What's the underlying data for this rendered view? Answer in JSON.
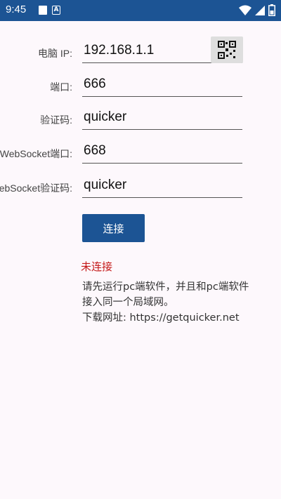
{
  "statusbar": {
    "time": "9:45",
    "notif_label": "A"
  },
  "form": {
    "ip_label": "电脑 IP:",
    "ip_value": "192.168.1.1",
    "port_label": "端口:",
    "port_value": "666",
    "code_label": "验证码:",
    "code_value": "quicker",
    "ws_port_label": "WebSocket端口:",
    "ws_port_value": "668",
    "ws_code_label": "WebSocket验证码:",
    "ws_code_value": "quicker"
  },
  "connect_label": "连接",
  "status_text": "未连接",
  "info": {
    "line1": "请先运行pc端软件，并且和pc端软件",
    "line2": "接入同一个局域网。",
    "line3": "下载网址: https://getquicker.net"
  },
  "colors": {
    "accent": "#1c5494",
    "status": "#c41818",
    "background": "#fdf8fc"
  },
  "icons": [
    "wifi-icon",
    "signal-icon",
    "battery-icon",
    "qr-code-icon"
  ]
}
